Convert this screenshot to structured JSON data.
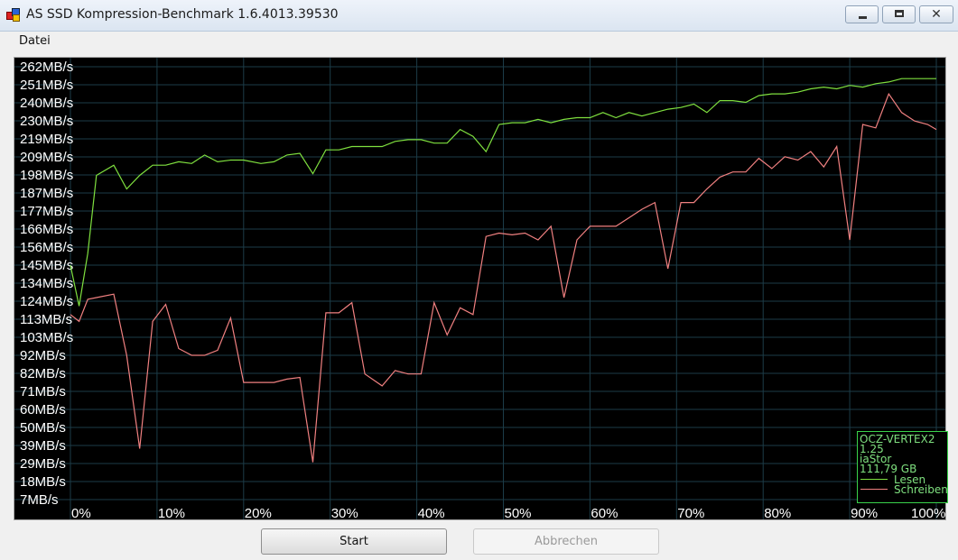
{
  "window": {
    "title": "AS SSD Kompression-Benchmark 1.6.4013.39530"
  },
  "menu": {
    "items": [
      "Datei"
    ]
  },
  "buttons": {
    "start": "Start",
    "abort": "Abbrechen"
  },
  "legend": {
    "model": "OCZ-VERTEX2",
    "firmware": "1.25",
    "driver": "iaStor",
    "size": "111,79 GB",
    "read_label": "Lesen",
    "write_label": "Schreiben"
  },
  "colors": {
    "read": "#7fe03f",
    "write": "#f08080",
    "grid": "#1c3c48",
    "background": "#000000"
  },
  "chart_data": {
    "type": "line",
    "yticks": [
      "262MB/s",
      "251MB/s",
      "240MB/s",
      "230MB/s",
      "219MB/s",
      "209MB/s",
      "198MB/s",
      "187MB/s",
      "177MB/s",
      "166MB/s",
      "156MB/s",
      "145MB/s",
      "134MB/s",
      "124MB/s",
      "113MB/s",
      "103MB/s",
      "92MB/s",
      "82MB/s",
      "71MB/s",
      "60MB/s",
      "50MB/s",
      "39MB/s",
      "29MB/s",
      "18MB/s",
      "7MB/s"
    ],
    "xticks": [
      "0%",
      "10%",
      "20%",
      "30%",
      "40%",
      "50%",
      "60%",
      "70%",
      "80%",
      "90%",
      "100%"
    ],
    "xlim": [
      0,
      100
    ],
    "ylim": [
      7,
      262
    ],
    "series": [
      {
        "name": "Lesen",
        "x": [
          0,
          1,
          2,
          3,
          5,
          6.5,
          8,
          9.5,
          11,
          12.5,
          14,
          15.5,
          17,
          18.5,
          20,
          22,
          23.5,
          25,
          26.5,
          28,
          29.5,
          31,
          32.5,
          34,
          36,
          37.5,
          39,
          40.5,
          42,
          43.5,
          45,
          46.5,
          48,
          49.5,
          51,
          52.5,
          54,
          55.5,
          57,
          58.5,
          60,
          61.5,
          63,
          64.5,
          66,
          67.5,
          69,
          70.5,
          72,
          73.5,
          75,
          76.5,
          78,
          79.5,
          81,
          82.5,
          84,
          85.5,
          87,
          88.5,
          90,
          91.5,
          93,
          94.5,
          96,
          97.5,
          99,
          100
        ],
        "y": [
          145,
          121,
          152,
          198,
          204,
          190,
          198,
          204,
          204,
          206,
          205,
          210,
          206,
          207,
          207,
          205,
          206,
          210,
          211,
          199,
          213,
          213,
          215,
          215,
          215,
          218,
          219,
          219,
          217,
          217,
          225,
          221,
          212,
          228,
          229,
          229,
          231,
          229,
          231,
          232,
          232,
          235,
          232,
          235,
          233,
          235,
          237,
          238,
          240,
          235,
          242,
          242,
          241,
          245,
          246,
          246,
          247,
          249,
          250,
          249,
          251,
          250,
          252,
          253,
          255,
          255,
          255,
          255
        ]
      },
      {
        "name": "Schreiben",
        "x": [
          0,
          1,
          2,
          3,
          5,
          6.5,
          8,
          9.5,
          11,
          12.5,
          14,
          15.5,
          17,
          18.5,
          20,
          22,
          23.5,
          25,
          26.5,
          28,
          29.5,
          31,
          32.5,
          34,
          36,
          37.5,
          39,
          40.5,
          42,
          43.5,
          45,
          46.5,
          48,
          49.5,
          51,
          52.5,
          54,
          55.5,
          57,
          58.5,
          60,
          61.5,
          63,
          64.5,
          66,
          67.5,
          69,
          70.5,
          72,
          73.5,
          75,
          76.5,
          78,
          79.5,
          81,
          82.5,
          84,
          85.5,
          87,
          88.5,
          90,
          91.5,
          93,
          94.5,
          96,
          97.5,
          99,
          100
        ],
        "y": [
          116,
          112,
          125,
          126,
          128,
          92,
          37,
          112,
          122,
          96,
          92,
          92,
          95,
          114,
          76,
          76,
          76,
          78,
          79,
          29,
          117,
          117,
          123,
          81,
          74,
          83,
          81,
          81,
          123,
          104,
          120,
          116,
          162,
          164,
          163,
          164,
          160,
          168,
          126,
          160,
          168,
          168,
          168,
          173,
          178,
          182,
          143,
          182,
          182,
          190,
          197,
          200,
          200,
          208,
          202,
          209,
          207,
          212,
          203,
          215,
          160,
          228,
          226,
          246,
          235,
          230,
          228,
          225
        ]
      }
    ],
    "grid": true,
    "legend_position": "bottom-right"
  }
}
